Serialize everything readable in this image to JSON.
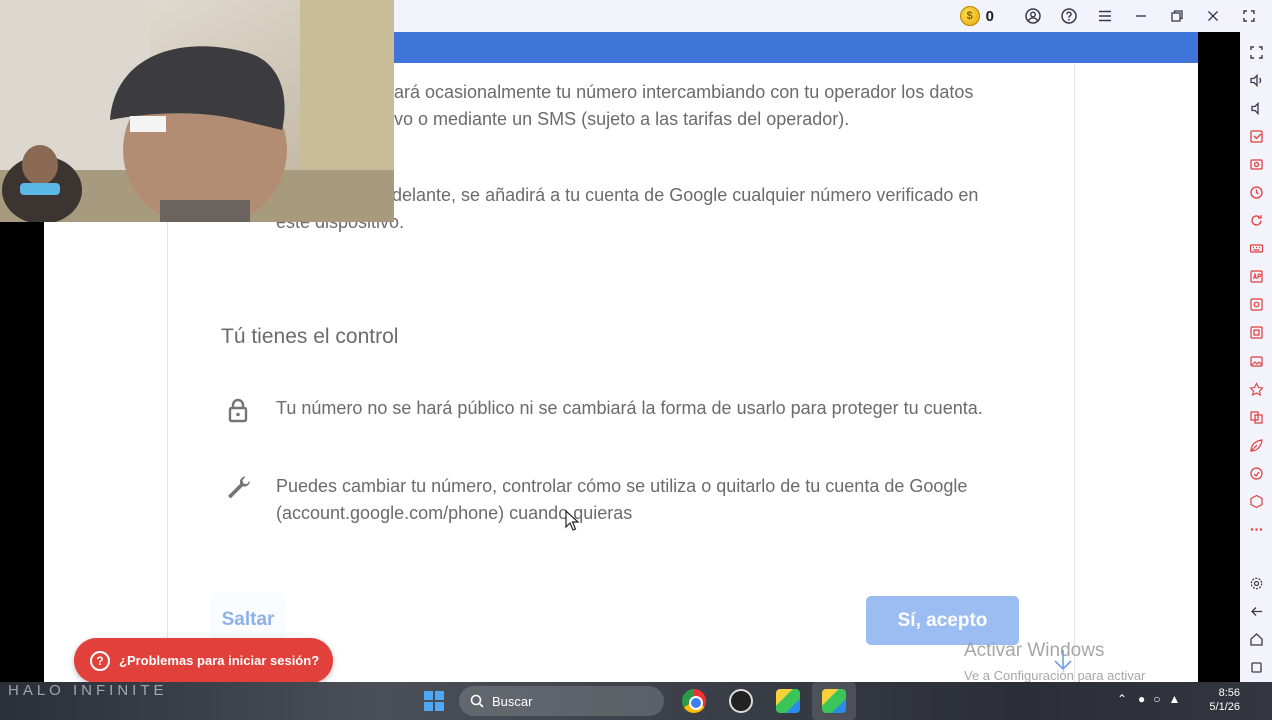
{
  "emulator": {
    "coin_count": "0",
    "coin_glyph": "$"
  },
  "page": {
    "para1": "ará ocasionalmente tu número intercambiando con tu operador los datos vo o mediante un SMS (sujeto a las tarifas del operador).",
    "para1_line1": "ará ocasionalmente tu número intercambiando con tu operador los datos",
    "para1_line2": "vo o mediante un SMS (sujeto a las tarifas del operador).",
    "para2_line1": "delante, se añadirá a tu cuenta de Google cualquier número verificado en",
    "para2_line2": "este dispositivo.",
    "section_title": "Tú tienes el control",
    "item1_text": "Tu número no se hará público ni se cambiará la forma de usarlo para proteger tu cuenta.",
    "item2_line1": "Puedes cambiar tu número, controlar cómo se utiliza o quitarlo de tu cuenta de Google",
    "item2_line2": "(account.google.com/phone) cuando quieras",
    "skip_label": "Saltar",
    "accept_label": "Sí, acepto",
    "help_label": "¿Problemas para iniciar sesión?",
    "help_glyph": "?"
  },
  "watermark": {
    "line1": "Activar Windows",
    "line2": "Ve a Configuración para activar Windows."
  },
  "taskbar": {
    "brand": "HALO INFINITE",
    "search_label": "Buscar",
    "time": "8:56",
    "date": "5/1/26"
  },
  "colors": {
    "app_bar": "#3f74d8",
    "accept_button": "#9cbdf2",
    "help_pill": "#e2403b",
    "sidebar_icon": "#e23b3b"
  }
}
